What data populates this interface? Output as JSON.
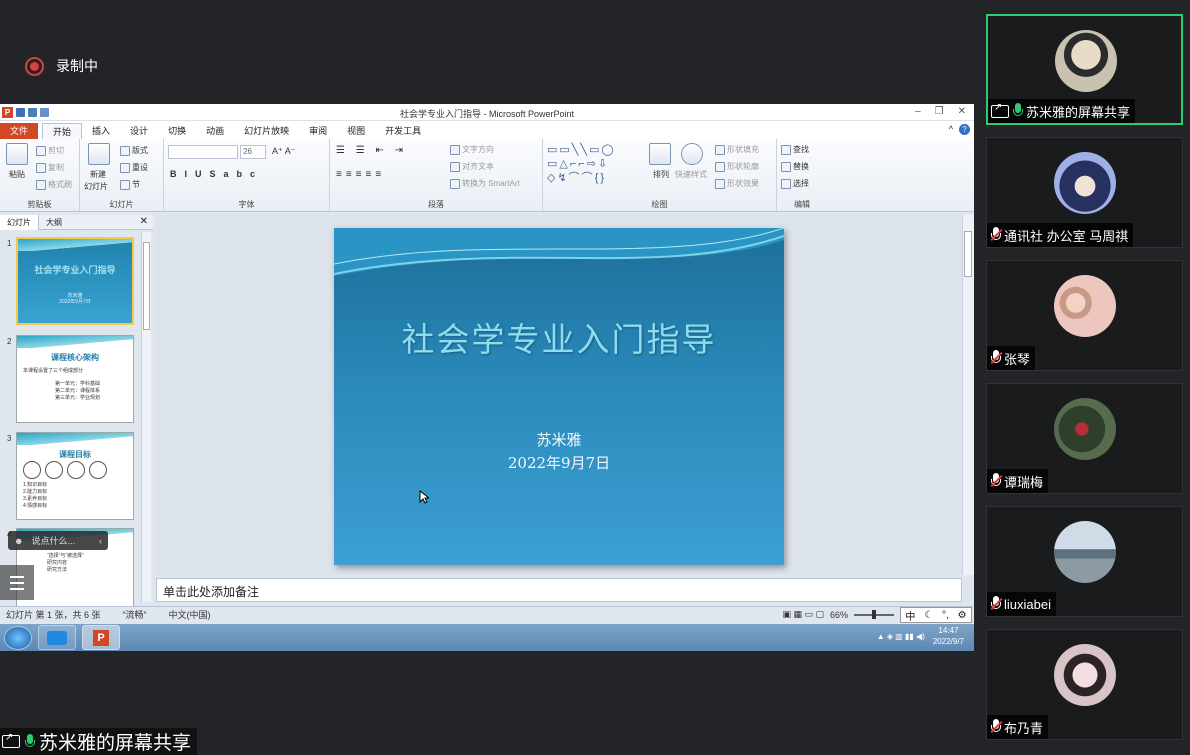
{
  "recording": {
    "label": "录制中"
  },
  "share_label": "苏米雅的屏幕共享",
  "ppt": {
    "window_title": "社会学专业入门指导 - Microsoft PowerPoint",
    "tabs": [
      "文件",
      "开始",
      "插入",
      "设计",
      "切换",
      "动画",
      "幻灯片放映",
      "审阅",
      "视图",
      "开发工具"
    ],
    "active_tab": "开始",
    "ribbon": {
      "clipboard": {
        "name": "剪贴板",
        "paste": "粘贴",
        "cut": "剪切",
        "copy": "复制",
        "format_painter": "格式刷"
      },
      "slides": {
        "name": "幻灯片",
        "new_slide_1": "新建",
        "new_slide_2": "幻灯片",
        "layout": "版式",
        "reset": "重设",
        "section": "节"
      },
      "font": {
        "name": "字体",
        "size": "26"
      },
      "paragraph": {
        "name": "段落",
        "text_direction": "文字方向",
        "align_text": "对齐文本",
        "smartart": "转换为 SmartArt"
      },
      "drawing": {
        "name": "绘图",
        "arrange": "排列",
        "quick_styles": "快速样式",
        "shape_fill": "形状填充",
        "shape_outline": "形状轮廓",
        "shape_effects": "形状效果"
      },
      "editing": {
        "name": "编辑",
        "find": "查找",
        "replace": "替换",
        "select": "选择"
      }
    },
    "pane_tabs": {
      "slides": "幻灯片",
      "outline": "大纲"
    },
    "thumbnails": [
      {
        "num": "1",
        "title": "社会学专业入门指导",
        "sub1": "苏米雅",
        "sub2": "2022年9月7日"
      },
      {
        "num": "2",
        "title": "课程核心架构",
        "lines": [
          "本课程设置了三个组成部分",
          "第一单元：学科基础",
          "第二单元：课程体系",
          "第三单元：学业规划"
        ]
      },
      {
        "num": "3",
        "title": "课程目标",
        "lines": [
          "1.知识目标",
          "2.能力目标",
          "3.素养目标",
          "4.情感目标"
        ]
      },
      {
        "num": "4",
        "title": "",
        "lines": [
          "“选择”与“被选择”",
          "研究内容",
          "研究方法"
        ]
      }
    ],
    "slide": {
      "title": "社会学专业入门指导",
      "author": "苏米雅",
      "date": "2022年9月7日"
    },
    "notes_placeholder": "单击此处添加备注",
    "status": {
      "slide_info": "幻灯片 第 1 张，共 6 张",
      "theme": "“流畅”",
      "language": "中文(中国)",
      "zoom": "66%"
    },
    "reaction_placeholder": "说点什么...",
    "ime": {
      "mode": "中"
    },
    "clock": {
      "time": "14:47",
      "date": "2022/9/7"
    }
  },
  "participants": [
    {
      "name": "苏米雅的屏幕共享",
      "mic": "on",
      "sharing": true,
      "avatar_color": "#c9c2b0"
    },
    {
      "name": "通讯社 办公室 马周祺",
      "mic": "off",
      "avatar_color": "#4b5aa8"
    },
    {
      "name": "张琴",
      "mic": "off",
      "avatar_color": "#e7b6b0"
    },
    {
      "name": "谭瑞梅",
      "mic": "off",
      "avatar_color": "#3d4e3a"
    },
    {
      "name": "liuxiabei",
      "mic": "off",
      "avatar_color": "#8fa8bf"
    },
    {
      "name": "布乃青",
      "mic": "off",
      "avatar_color": "#d8c3c7"
    }
  ]
}
